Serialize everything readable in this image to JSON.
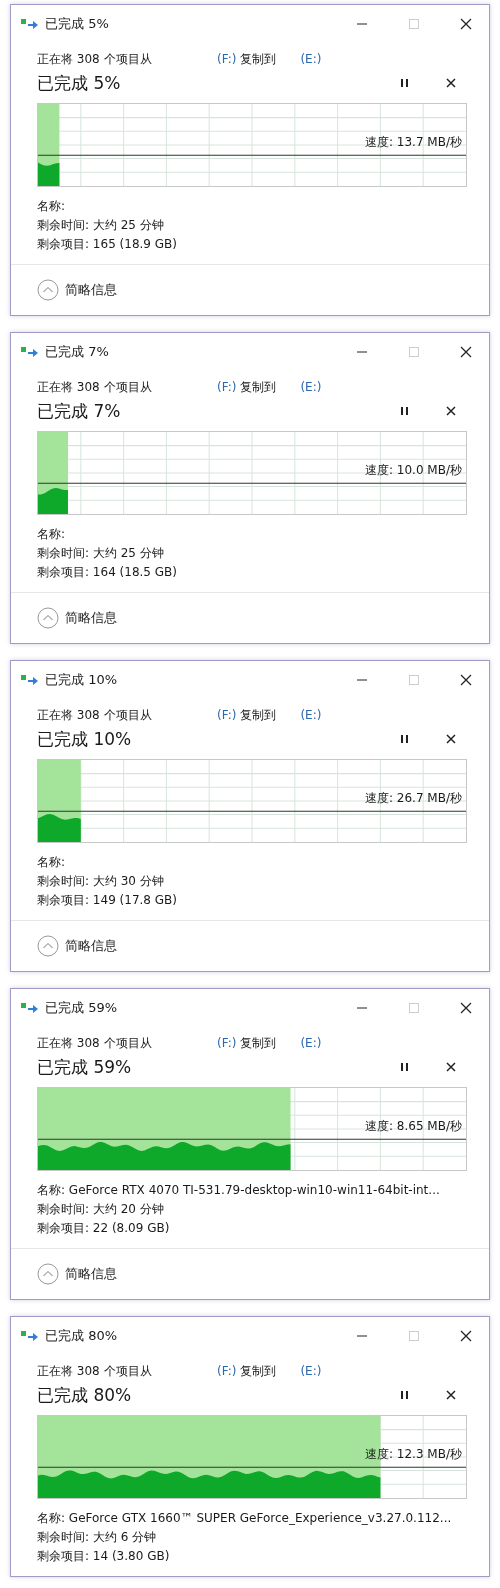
{
  "dialogs": [
    {
      "title": "已完成 5%",
      "source_text": "正在将 308 个项目从",
      "source_drive": "(F:)",
      "copy_to": "复制到",
      "target_drive": "(E:)",
      "heading": "已完成 5%",
      "level": 0.05,
      "speed": "速度: 13.7 MB/秒",
      "name": "名称:",
      "time_left": "剩余时间: 大约 25 分钟",
      "items_left": "剩余项目: 165 (18.9 GB)",
      "footer": "简略信息"
    },
    {
      "title": "已完成 7%",
      "source_text": "正在将 308 个项目从",
      "source_drive": "(F:)",
      "copy_to": "复制到",
      "target_drive": "(E:)",
      "heading": "已完成 7%",
      "level": 0.07,
      "speed": "速度: 10.0 MB/秒",
      "name": "名称:",
      "time_left": "剩余时间: 大约 25 分钟",
      "items_left": "剩余项目: 164 (18.5 GB)",
      "footer": "简略信息"
    },
    {
      "title": "已完成 10%",
      "source_text": "正在将 308 个项目从",
      "source_drive": "(F:)",
      "copy_to": "复制到",
      "target_drive": "(E:)",
      "heading": "已完成 10%",
      "level": 0.1,
      "speed": "速度: 26.7 MB/秒",
      "name": "名称:",
      "time_left": "剩余时间: 大约 30 分钟",
      "items_left": "剩余项目: 149 (17.8 GB)",
      "footer": "简略信息"
    },
    {
      "title": "已完成 59%",
      "source_text": "正在将 308 个项目从",
      "source_drive": "(F:)",
      "copy_to": "复制到",
      "target_drive": "(E:)",
      "heading": "已完成 59%",
      "level": 0.59,
      "speed": "速度: 8.65 MB/秒",
      "name": "名称: GeForce RTX 4070 TI-531.79-desktop-win10-win11-64bit-int...",
      "time_left": "剩余时间: 大约 20 分钟",
      "items_left": "剩余项目: 22 (8.09 GB)",
      "footer": "简略信息"
    },
    {
      "title": "已完成 80%",
      "source_text": "正在将 308 个项目从",
      "source_drive": "(F:)",
      "copy_to": "复制到",
      "target_drive": "(E:)",
      "heading": "已完成 80%",
      "level": 0.8,
      "speed": "速度: 12.3 MB/秒",
      "name": "名称: GeForce GTX 1660™ SUPER GeForce_Experience_v3.27.0.112...",
      "time_left": "剩余时间: 大约 6 分钟",
      "items_left": "剩余项目: 14 (3.80 GB)"
    }
  ]
}
